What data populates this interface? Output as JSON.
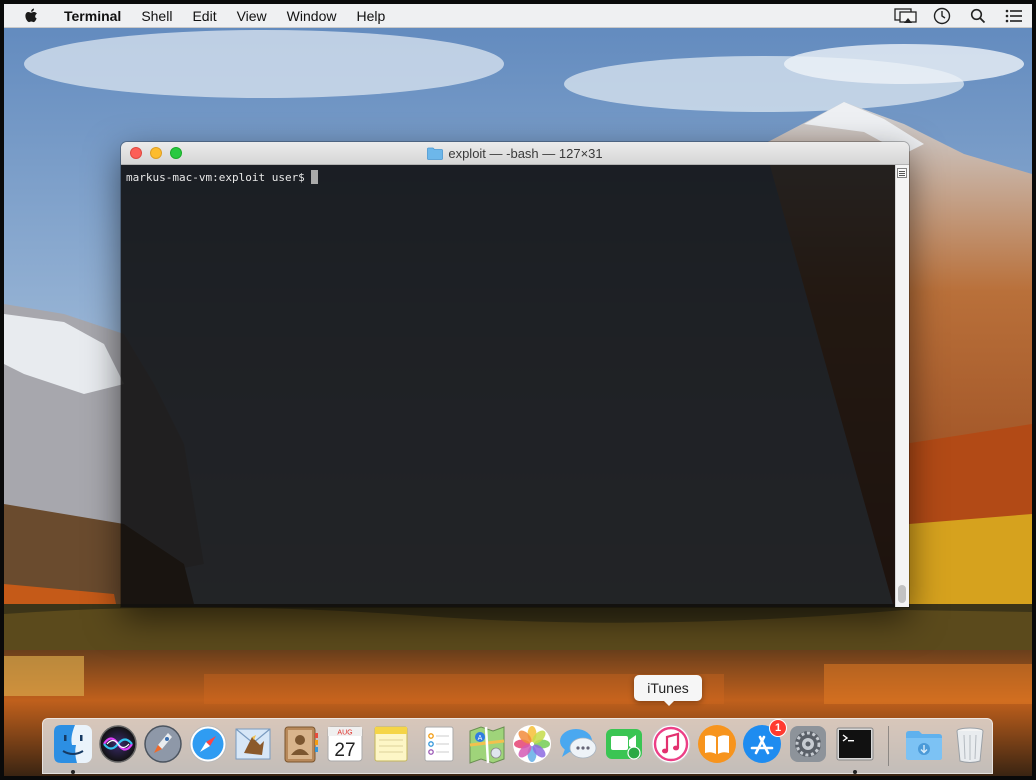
{
  "menubar": {
    "app_name": "Terminal",
    "menus": [
      "Shell",
      "Edit",
      "View",
      "Window",
      "Help"
    ],
    "status_icons": [
      "airplay-display-icon",
      "time-machine-icon",
      "spotlight-search-icon",
      "notification-center-icon"
    ]
  },
  "terminal": {
    "window_title": "exploit — -bash — 127×31",
    "prompt": "markus-mac-vm:exploit user$"
  },
  "tooltip": {
    "text": "iTunes"
  },
  "calendar": {
    "month": "AUG",
    "day": "27"
  },
  "dock": {
    "items": [
      {
        "name": "Finder",
        "icon": "finder-icon",
        "running": true
      },
      {
        "name": "Siri",
        "icon": "siri-icon",
        "running": false
      },
      {
        "name": "Launchpad",
        "icon": "launchpad-icon",
        "running": false
      },
      {
        "name": "Safari",
        "icon": "safari-icon",
        "running": false
      },
      {
        "name": "Mail",
        "icon": "mail-icon",
        "running": false
      },
      {
        "name": "Contacts",
        "icon": "contacts-icon",
        "running": false
      },
      {
        "name": "Calendar",
        "icon": "calendar-icon",
        "running": false
      },
      {
        "name": "Notes",
        "icon": "notes-icon",
        "running": false
      },
      {
        "name": "Reminders",
        "icon": "reminders-icon",
        "running": false
      },
      {
        "name": "Maps",
        "icon": "maps-icon",
        "running": false
      },
      {
        "name": "Photos",
        "icon": "photos-icon",
        "running": false
      },
      {
        "name": "Messages",
        "icon": "messages-icon",
        "running": false
      },
      {
        "name": "FaceTime",
        "icon": "facetime-icon",
        "running": false
      },
      {
        "name": "iTunes",
        "icon": "itunes-icon",
        "running": false
      },
      {
        "name": "iBooks",
        "icon": "ibooks-icon",
        "running": false
      },
      {
        "name": "App Store",
        "icon": "app-store-icon",
        "running": false,
        "badge": "1"
      },
      {
        "name": "System Preferences",
        "icon": "system-preferences-icon",
        "running": false
      },
      {
        "name": "Terminal",
        "icon": "terminal-icon",
        "running": true
      },
      {
        "name": "Downloads",
        "icon": "downloads-folder-icon",
        "running": false
      },
      {
        "name": "Trash",
        "icon": "trash-icon",
        "running": false
      }
    ]
  },
  "colors": {
    "close": "#fc5f57",
    "minimize": "#fdbc2e",
    "zoom": "#28c940",
    "badge": "#ff3b30"
  }
}
